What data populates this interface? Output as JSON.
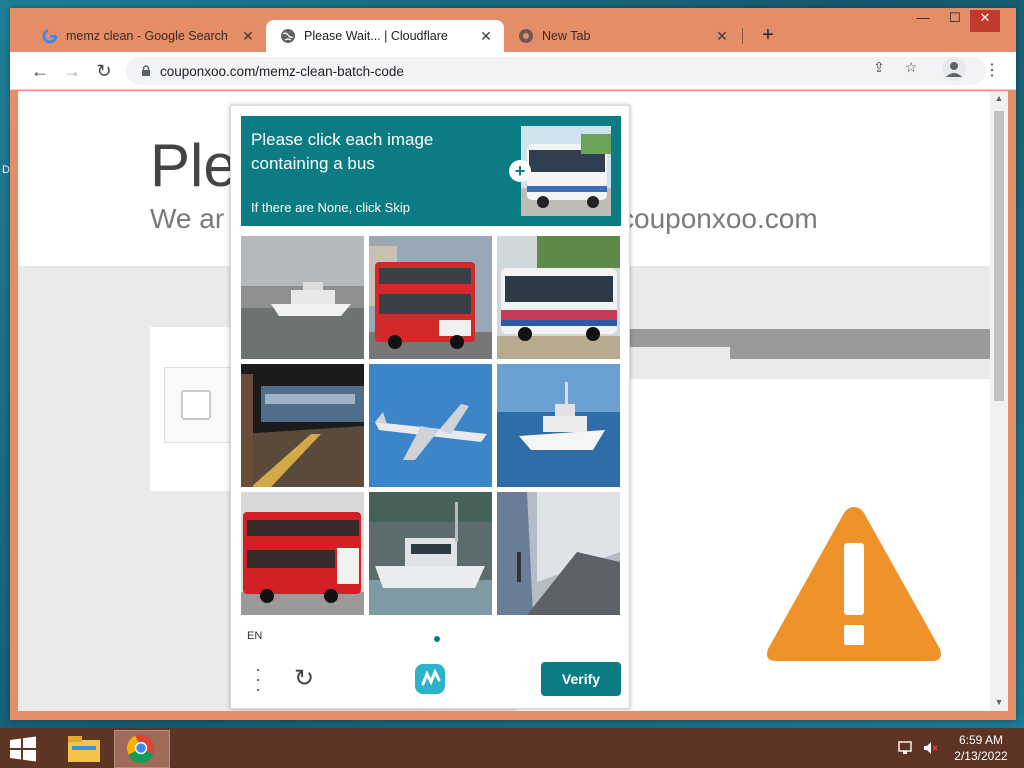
{
  "tabs": [
    {
      "title": "memz clean - Google Search",
      "icon": "google-icon"
    },
    {
      "title": "Please Wait... | Cloudflare",
      "icon": "globe-icon"
    },
    {
      "title": "New Tab",
      "icon": "chrome-icon"
    }
  ],
  "address_bar": {
    "url": "couponxoo.com/memz-clean-batch-code"
  },
  "page": {
    "title_fragment": "Ple",
    "sub_fragment": "We ar",
    "sub_right": "couponxoo.com"
  },
  "captcha": {
    "prompt": "Please click each image containing a bus",
    "skip_hint": "If there are None, click Skip",
    "language": "EN",
    "verify_label": "Verify",
    "tiles": [
      "boat-image",
      "red-double-decker-bus-image",
      "city-bus-image",
      "train-platform-image",
      "airplane-image",
      "motor-yacht-image",
      "red-double-decker-bus-image",
      "fishing-boat-image",
      "train-station-image"
    ],
    "accent_color": "#0b7c84"
  },
  "desktop": {
    "side_label": "D"
  },
  "taskbar": {
    "time": "6:59 AM",
    "date": "2/13/2022"
  },
  "colors": {
    "window_frame": "#e48d66",
    "taskbar": "#5e3524",
    "warning": "#f0922a"
  }
}
